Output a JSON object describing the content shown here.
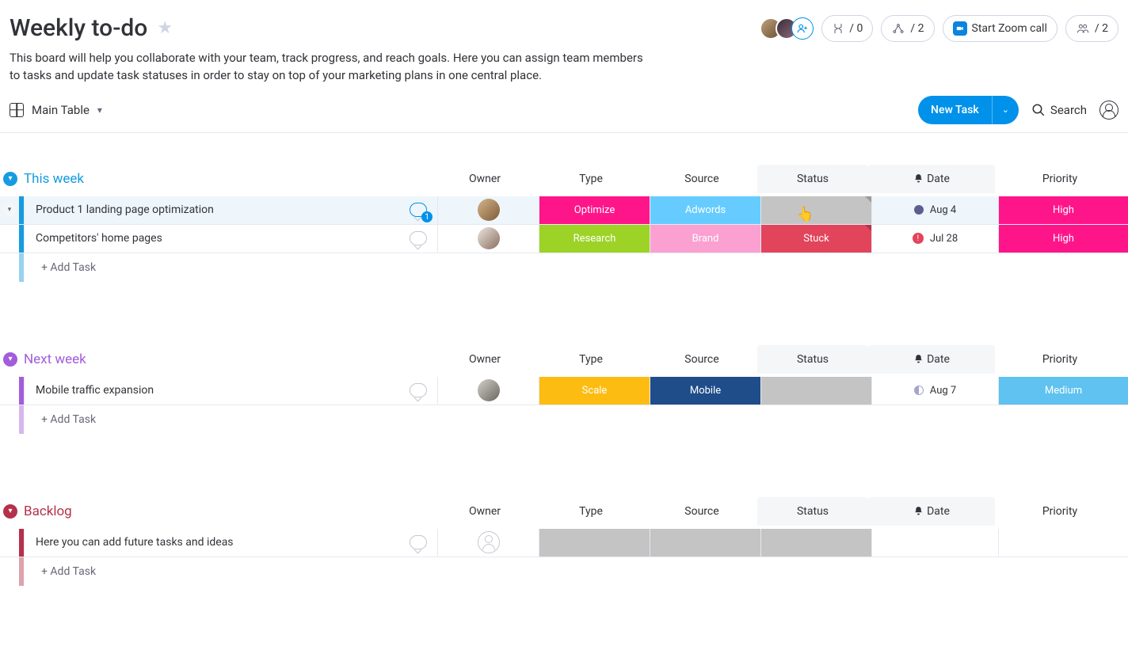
{
  "header": {
    "title": "Weekly to-do",
    "description": "This board will help you collaborate with your team, track progress, and reach goals. Here you can assign team members to tasks and update task statuses in order to stay on top of your marketing plans in one central place.",
    "counters": {
      "activity": "/ 0",
      "integrations": "/ 2",
      "people": "/ 2"
    },
    "zoom_label": "Start Zoom call"
  },
  "toolbar": {
    "view_label": "Main Table",
    "new_task_label": "New Task",
    "search_label": "Search"
  },
  "columns": {
    "owner": "Owner",
    "type": "Type",
    "source": "Source",
    "status": "Status",
    "date": "Date",
    "priority": "Priority"
  },
  "add_task_label": "+ Add Task",
  "colors": {
    "blue": "#169be0",
    "purple": "#a25ddc",
    "red": "#b5304a",
    "pink": "#ff158a",
    "skyblue": "#66ccff",
    "lime": "#9cd326",
    "lightpink": "#faa1d1",
    "stuck": "#e2445c",
    "yellow": "#fdbc12",
    "navy": "#1f4d8a",
    "sky": "#5fc2f0",
    "grey": "#c4c4c4"
  },
  "groups": [
    {
      "name": "This week",
      "color": "#169be0",
      "rows": [
        {
          "name": "Product 1 landing page optimization",
          "convo_count": "1",
          "owner": "a",
          "type": {
            "label": "Optimize",
            "color": "#ff158a"
          },
          "source": {
            "label": "Adwords",
            "color": "#66ccff"
          },
          "status": {
            "label": "",
            "color": "#c4c4c4",
            "editing": true
          },
          "date": {
            "label": "Aug 4",
            "indicator": "dot",
            "indicator_color": "#5e5e8e"
          },
          "priority": {
            "label": "High",
            "color": "#ff158a"
          },
          "highlight": true,
          "expandable": true
        },
        {
          "name": "Competitors' home pages",
          "convo_count": "",
          "owner": "b",
          "type": {
            "label": "Research",
            "color": "#9cd326"
          },
          "source": {
            "label": "Brand",
            "color": "#faa1d1"
          },
          "status": {
            "label": "Stuck",
            "color": "#e2445c"
          },
          "date": {
            "label": "Jul 28",
            "indicator": "alert"
          },
          "priority": {
            "label": "High",
            "color": "#ff158a"
          }
        }
      ]
    },
    {
      "name": "Next week",
      "color": "#a25ddc",
      "rows": [
        {
          "name": "Mobile traffic expansion",
          "convo_count": "",
          "owner": "c",
          "type": {
            "label": "Scale",
            "color": "#fdbc12"
          },
          "source": {
            "label": "Mobile",
            "color": "#1f4d8a"
          },
          "status": {
            "label": "",
            "color": "#c4c4c4"
          },
          "date": {
            "label": "Aug 7",
            "indicator": "half"
          },
          "priority": {
            "label": "Medium",
            "color": "#5fc2f0"
          }
        }
      ]
    },
    {
      "name": "Backlog",
      "color": "#b5304a",
      "rows": [
        {
          "name": "Here you can add future tasks and ideas",
          "convo_count": "",
          "owner": "empty",
          "type": {
            "label": "",
            "color": "#c4c4c4"
          },
          "source": {
            "label": "",
            "color": "#c4c4c4"
          },
          "status": {
            "label": "",
            "color": "#c4c4c4"
          },
          "date": {
            "label": "",
            "indicator": ""
          },
          "priority": {
            "label": "",
            "color": "#ffffff"
          }
        }
      ]
    }
  ]
}
